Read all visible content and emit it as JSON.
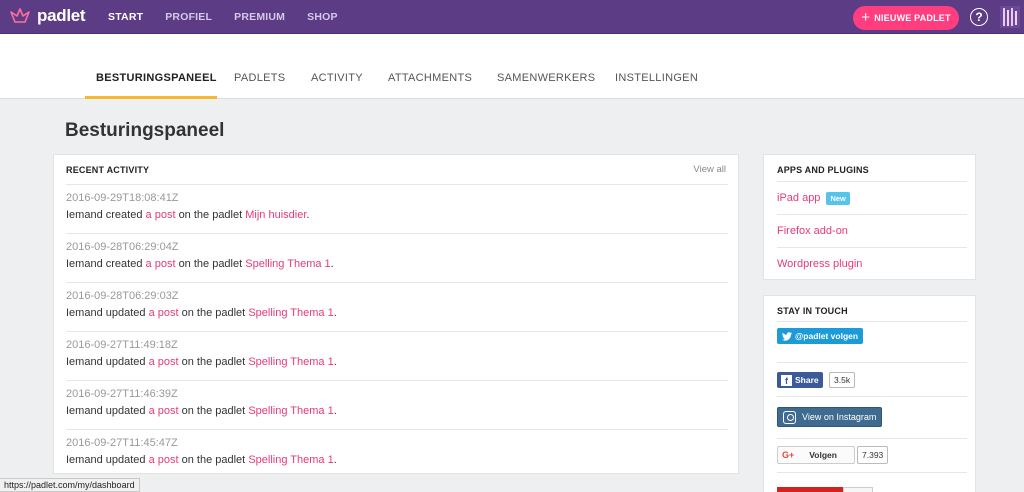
{
  "topbar": {
    "logo_text": "padlet",
    "nav": [
      "START",
      "PROFIEL",
      "PREMIUM",
      "SHOP"
    ],
    "new_padlet_label": "NIEUWE PADLET",
    "help_glyph": "?",
    "colors": {
      "bar": "#5c3c85",
      "accent": "#ff3d7f"
    }
  },
  "tabs": [
    "BESTURINGSPANEEL",
    "PADLETS",
    "ACTIVITY",
    "ATTACHMENTS",
    "SAMENWERKERS",
    "INSTELLINGEN"
  ],
  "page_title": "Besturingspaneel",
  "recent_activity": {
    "title": "RECENT ACTIVITY",
    "view_all": "View all",
    "items": [
      {
        "time": "2016-09-29T18:08:41Z",
        "actor": "Iemand",
        "verb": "created",
        "post": "a post",
        "middle": "on the padlet",
        "padlet": "Mijn huisdier"
      },
      {
        "time": "2016-09-28T06:29:04Z",
        "actor": "Iemand",
        "verb": "created",
        "post": "a post",
        "middle": "on the padlet",
        "padlet": "Spelling Thema 1"
      },
      {
        "time": "2016-09-28T06:29:03Z",
        "actor": "Iemand",
        "verb": "updated",
        "post": "a post",
        "middle": "on the padlet",
        "padlet": "Spelling Thema 1"
      },
      {
        "time": "2016-09-27T11:49:18Z",
        "actor": "Iemand",
        "verb": "updated",
        "post": "a post",
        "middle": "on the padlet",
        "padlet": "Spelling Thema 1"
      },
      {
        "time": "2016-09-27T11:46:39Z",
        "actor": "Iemand",
        "verb": "updated",
        "post": "a post",
        "middle": "on the padlet",
        "padlet": "Spelling Thema 1"
      },
      {
        "time": "2016-09-27T11:45:47Z",
        "actor": "Iemand",
        "verb": "updated",
        "post": "a post",
        "middle": "on the padlet",
        "padlet": "Spelling Thema 1"
      }
    ]
  },
  "apps": {
    "title": "APPS AND PLUGINS",
    "items": [
      {
        "label": "iPad app",
        "badge": "New"
      },
      {
        "label": "Firefox add-on"
      },
      {
        "label": "Wordpress plugin"
      }
    ]
  },
  "stay_in_touch": {
    "title": "STAY IN TOUCH",
    "twitter_label": "@padlet volgen",
    "facebook_label": "Share",
    "facebook_count": "3.5k",
    "instagram_label": "View on Instagram",
    "gplus_logo": "G+",
    "gplus_label": "Volgen",
    "gplus_count": "7.393"
  },
  "status_url": "https://padlet.com/my/dashboard"
}
